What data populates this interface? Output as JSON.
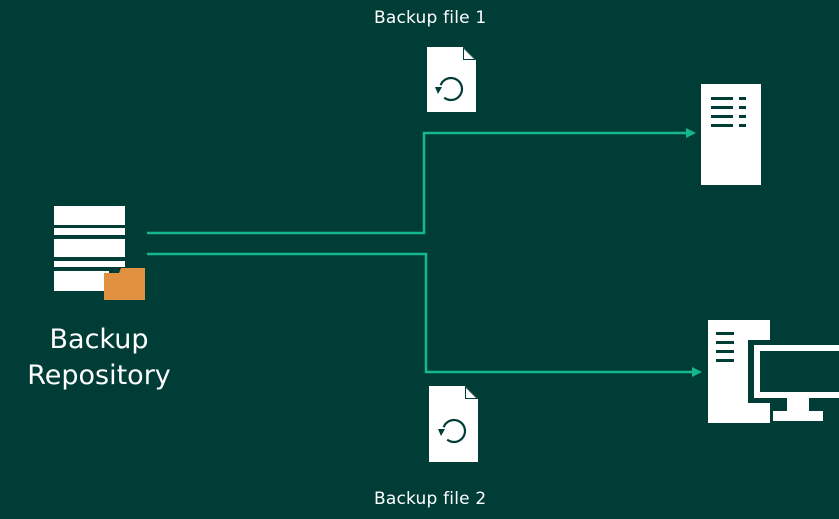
{
  "diagram": {
    "repository": {
      "line1": "Backup",
      "line2": "Repository",
      "icon": "server-stack-with-folder-icon"
    },
    "files": [
      {
        "label": "Backup file 1",
        "icon": "restore-file-icon"
      },
      {
        "label": "Backup file 2",
        "icon": "restore-file-icon"
      }
    ],
    "targets": [
      {
        "icon": "server-tower-icon"
      },
      {
        "icon": "desktop-computer-icon"
      }
    ],
    "colors": {
      "background": "#013d37",
      "connector": "#14b88a",
      "icon": "#ffffff",
      "folder_accent": "#e0903f"
    }
  }
}
